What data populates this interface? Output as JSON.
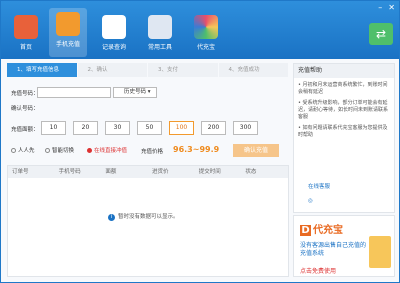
{
  "nav": [
    {
      "label": "首页",
      "icon": "home-icon",
      "color": "#e8613a"
    },
    {
      "label": "手机充值",
      "icon": "phone-charge-icon",
      "color": "#f29a2e"
    },
    {
      "label": "记录查询",
      "icon": "record-query-icon",
      "color": "#ffffff"
    },
    {
      "label": "常用工具",
      "icon": "tools-icon",
      "color": "#3a7bd5"
    },
    {
      "label": "代充宝",
      "icon": "pinwheel-icon",
      "color": "#e94e6a"
    }
  ],
  "steps": [
    "1、填写充值信息",
    "2、确认",
    "3、支付",
    "4、充值成功"
  ],
  "form": {
    "phone_label": "充值号码：",
    "phone_placeholder": "",
    "history_label": "历史号码",
    "confirm_label": "确认号码：",
    "amount_label": "充值面额：",
    "amounts": [
      "10",
      "20",
      "30",
      "50",
      "100",
      "200",
      "300"
    ],
    "selected_amount": "100",
    "options": [
      "人人先",
      "智能切换",
      "在线直接冲值"
    ],
    "price_label": "充值价格",
    "price_value": "96.3~99.9",
    "submit_label": "确认充值"
  },
  "table": {
    "columns": [
      "订单号",
      "手机号码",
      "面额",
      "进货价",
      "提交时间",
      "状态"
    ],
    "empty_text": "暂时没有数据可以显示。"
  },
  "help": {
    "title": "充值帮助",
    "lines": [
      "• 月初和月末运营商系统繁忙，到账时间会稍有延迟",
      "• 受系统升级影响，部分订单可能会有延迟，请耐心等待，如长时间未到账请联系客服",
      "• 如有问题请联系代充宝客服为您提供及时帮助"
    ],
    "service_label": "在线客服"
  },
  "promo": {
    "brand": "代充宝",
    "desc": "没有客源出售自己充值的充值系统",
    "cta": "点击免费使用"
  }
}
